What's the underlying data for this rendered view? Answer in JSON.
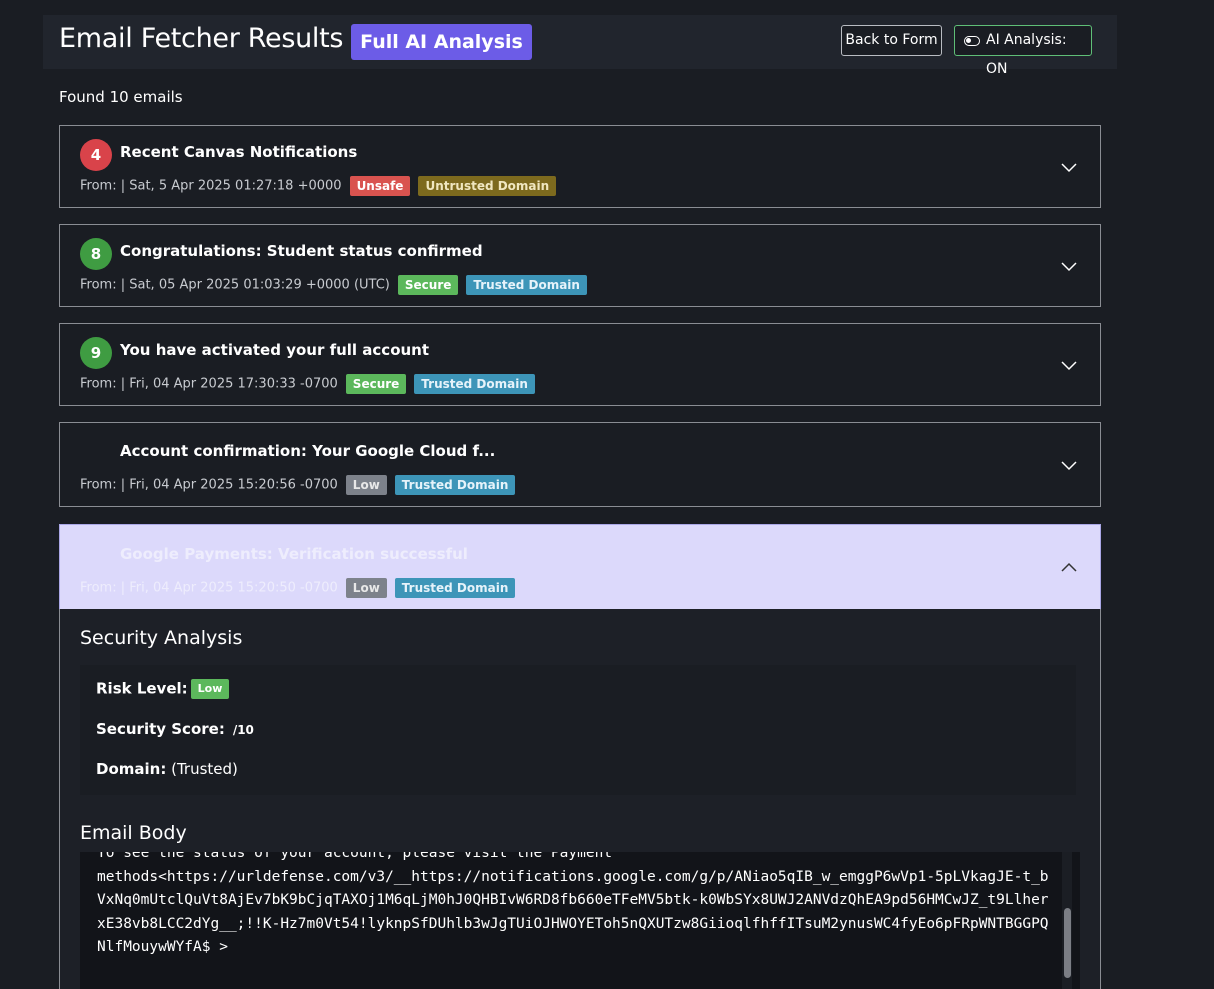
{
  "header": {
    "title": "Email Fetcher Results",
    "analysis_badge": "Full AI Analysis",
    "back_button": "Back to Form",
    "ai_toggle_label": "AI Analysis: ON"
  },
  "summary": {
    "found_text": "Found 10 emails"
  },
  "emails": [
    {
      "score": "4",
      "subject": "Recent Canvas Notifications",
      "meta": "From: | Sat, 5 Apr 2025 01:27:18 +0000",
      "status": "Unsafe",
      "domain": "Untrusted Domain"
    },
    {
      "score": "8",
      "subject": "Congratulations: Student status confirmed",
      "meta": "From: | Sat, 05 Apr 2025 01:03:29 +0000 (UTC)",
      "status": "Secure",
      "domain": "Trusted Domain"
    },
    {
      "score": "9",
      "subject": "You have activated your full account",
      "meta": "From: | Fri, 04 Apr 2025 17:30:33 -0700",
      "status": "Secure",
      "domain": "Trusted Domain"
    },
    {
      "score": "",
      "subject": "Account confirmation: Your Google Cloud f...",
      "meta": "From: | Fri, 04 Apr 2025 15:20:56 -0700",
      "status": "Low",
      "domain": "Trusted Domain"
    },
    {
      "score": "",
      "subject": "Google Payments: Verification successful",
      "meta": "From: | Fri, 04 Apr 2025 15:20:50 -0700",
      "status": "Low",
      "domain": "Trusted Domain"
    }
  ],
  "analysis": {
    "section_title": "Security Analysis",
    "risk_label": "Risk Level:",
    "risk_value": "Low",
    "score_label": "Security Score:",
    "score_suffix": "/10",
    "domain_label": "Domain:",
    "domain_value": "(Trusted)",
    "body_title": "Email Body",
    "body_text": "To see the status of your account, please visit the Payment\nmethods<https://urldefense.com/v3/__https://notifications.google.com/g/p/ANiao5qIB_w_emggP6wVp1-5pLVkagJE-t_bVxNq0mUtclQuVt8AjEv7bK9bCjqTAXOj1M6qLjM0hJ0QHBIvW6RD8fb660eTFeMV5btk-k0WbSYx8UWJ2ANVdzQhEA9pd56HMCwJZ_t9LlherxE38vb8LCC2dYg__;!!K-Hz7m0Vt54!lyknpSfDUhlb3wJgTUiOJHWOYETоh5nQXUTzw8GiioqlfhffITsuM2ynusWC4fyEo6pFRpWNTBGGPQNlfMouywWYfA$ >"
  },
  "colors": {
    "background": "#1a1d23",
    "accent": "#6c5ce7",
    "unsafe": "#d9534f",
    "secure": "#5cb85c",
    "trusted": "#3d95b8",
    "expanded": "#dcd9fb"
  }
}
